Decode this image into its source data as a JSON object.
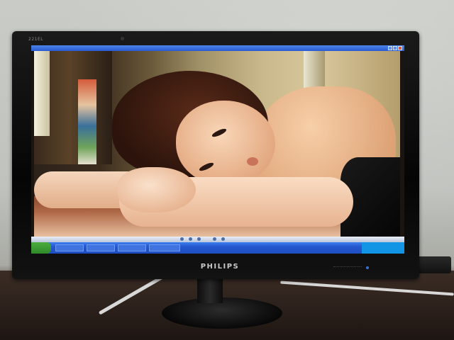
{
  "scene": {
    "monitor_model": "221EL",
    "monitor_brand": "PHILIPS"
  },
  "screen": {
    "window_title": "",
    "taskbar_items": [
      "",
      "",
      "",
      ""
    ]
  },
  "colors": {
    "titlebar": "#2a5bd0",
    "taskbar": "#2456cc",
    "start_button": "#2f8a2a",
    "power_led": "#3b6fd6"
  }
}
